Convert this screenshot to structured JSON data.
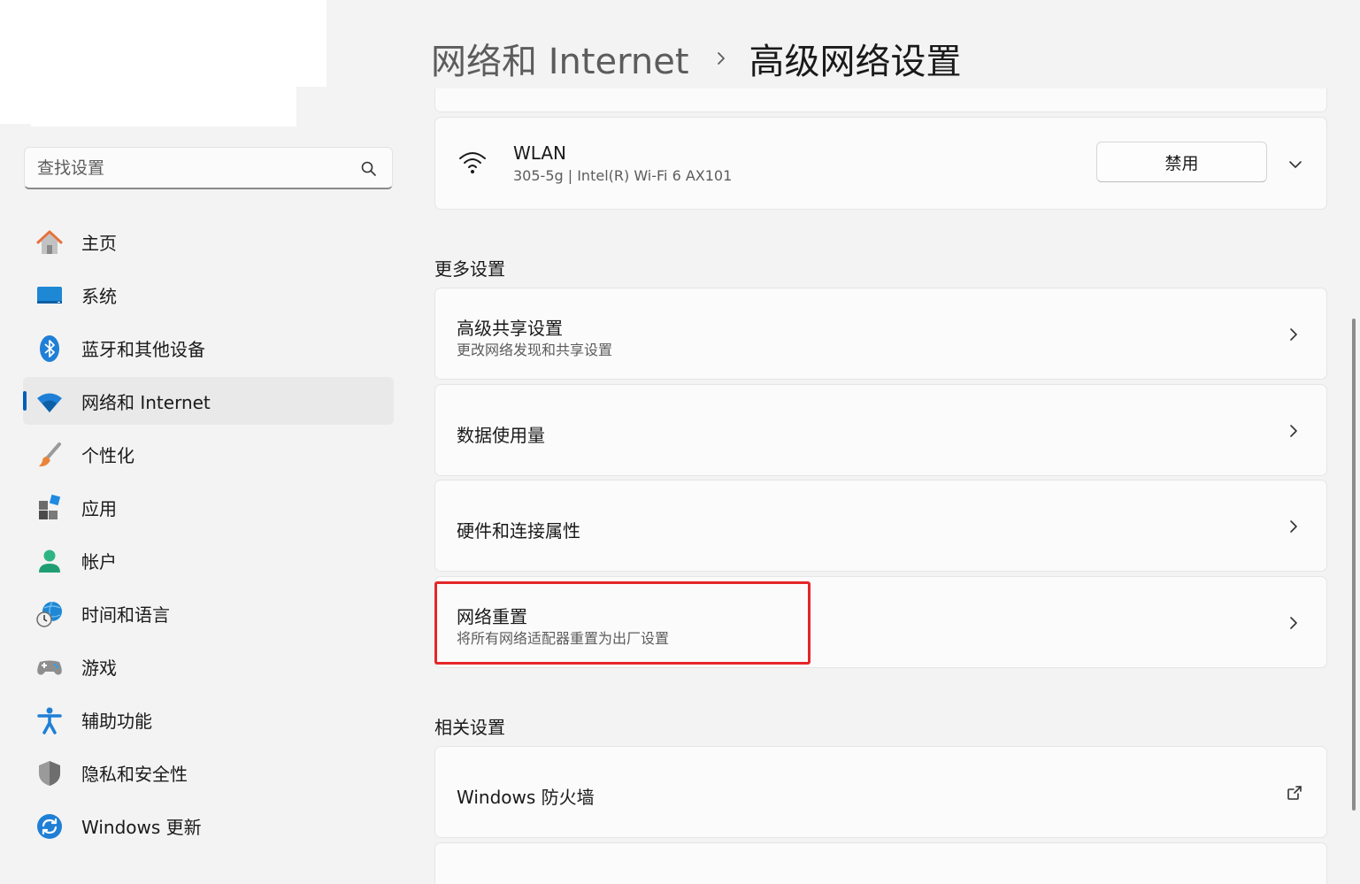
{
  "search": {
    "placeholder": "查找设置"
  },
  "nav": {
    "items": [
      {
        "label": "主页",
        "icon": "home-icon"
      },
      {
        "label": "系统",
        "icon": "monitor-icon"
      },
      {
        "label": "蓝牙和其他设备",
        "icon": "bluetooth-icon"
      },
      {
        "label": "网络和 Internet",
        "icon": "wifi-icon",
        "active": true
      },
      {
        "label": "个性化",
        "icon": "brush-icon"
      },
      {
        "label": "应用",
        "icon": "apps-icon"
      },
      {
        "label": "帐户",
        "icon": "person-icon"
      },
      {
        "label": "时间和语言",
        "icon": "globe-clock-icon"
      },
      {
        "label": "游戏",
        "icon": "gamepad-icon"
      },
      {
        "label": "辅助功能",
        "icon": "accessibility-icon"
      },
      {
        "label": "隐私和安全性",
        "icon": "shield-icon"
      },
      {
        "label": "Windows 更新",
        "icon": "update-icon"
      }
    ]
  },
  "breadcrumb": {
    "parent": "网络和 Internet",
    "current": "高级网络设置"
  },
  "adapter": {
    "name": "WLAN",
    "details": "305-5g | Intel(R) Wi-Fi 6 AX101",
    "disable_label": "禁用"
  },
  "more_settings": {
    "header": "更多设置",
    "items": [
      {
        "title": "高级共享设置",
        "subtitle": "更改网络发现和共享设置"
      },
      {
        "title": "数据使用量"
      },
      {
        "title": "硬件和连接属性"
      },
      {
        "title": "网络重置",
        "subtitle": "将所有网络适配器重置为出厂设置"
      }
    ]
  },
  "related_settings": {
    "header": "相关设置",
    "items": [
      {
        "title": "Windows 防火墙"
      }
    ]
  },
  "colors": {
    "accent": "#005fb8",
    "highlight": "#e5262a"
  }
}
